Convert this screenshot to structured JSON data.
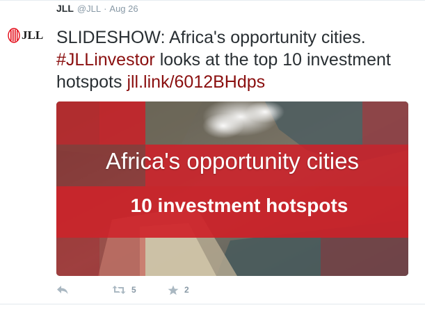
{
  "tweet": {
    "author_name": "JLL",
    "author_handle": "@JLL",
    "separator": "·",
    "timestamp": "Aug 26",
    "avatar_text": "JLL",
    "text_line1": "SLIDESHOW: Africa's opportunity cities.",
    "hashtag": "#JLLinvestor",
    "text_line2_rest": " looks at the top 10 investment",
    "text_line3_start": "hotspots ",
    "link": "jll.link/6012BHdps"
  },
  "media": {
    "title": "Africa's opportunity cities",
    "subtitle": "10 investment hotspots"
  },
  "actions": {
    "reply_icon": "reply-icon",
    "retweet_icon": "retweet-icon",
    "favorite_icon": "star-icon",
    "retweet_count": "5",
    "favorite_count": "2"
  },
  "colors": {
    "brand_red": "#e30613",
    "link": "#8a0f0f",
    "muted": "#8899a6",
    "text": "#292f33"
  }
}
